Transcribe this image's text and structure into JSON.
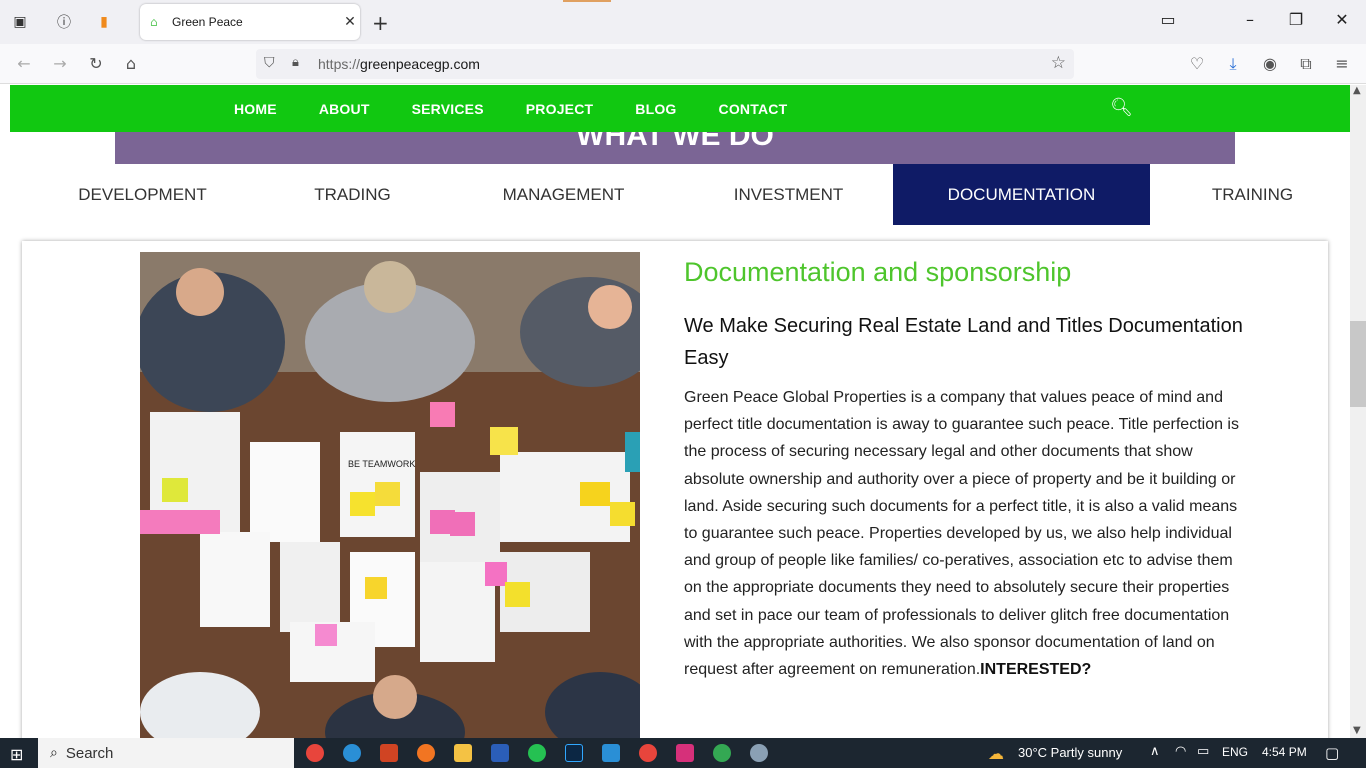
{
  "browser": {
    "tab_title": "Green Peace",
    "url_protocol": "https://",
    "url_host": "greenpeacegp.com"
  },
  "nav": {
    "items": [
      "HOME",
      "ABOUT",
      "SERVICES",
      "PROJECT",
      "BLOG",
      "CONTACT"
    ]
  },
  "section": {
    "heading": "WHAT WE DO"
  },
  "tabs": [
    "DEVELOPMENT",
    "TRADING",
    "MANAGEMENT",
    "INVESTMENT",
    "DOCUMENTATION",
    "TRAINING"
  ],
  "active_tab": "DOCUMENTATION",
  "content": {
    "title": "Documentation and sponsorship",
    "subtitle": "We Make Securing Real Estate Land and Titles Documentation Easy",
    "body": "Green Peace Global Properties is a company that values peace of mind and perfect title documentation is away to guarantee such peace. Title perfection is the process of securing necessary legal and other documents that show absolute ownership and authority over a piece of property and be it building or land. Aside securing such documents for a perfect title, it is also a valid means to guarantee such peace. Properties developed by us, we also help individual and group of people like families/ co-peratives, association etc to advise them on the appropriate documents they need to absolutely secure their properties and set in pace our team of professionals to deliver glitch free documentation with the appropriate authorities. We also sponsor documentation of land on request after agreement on remuneration.",
    "cta": "INTERESTED?",
    "image_caption": "BE TEAMWORK"
  },
  "taskbar": {
    "search_label": "Search",
    "weather": "30°C  Partly sunny",
    "lang": "ENG",
    "time": "4:54 PM"
  },
  "colors": {
    "nav_green": "#11c811",
    "heading_purple": "#7b6595",
    "active_tab": "#0f1b66",
    "title_green": "#4ec52c"
  }
}
